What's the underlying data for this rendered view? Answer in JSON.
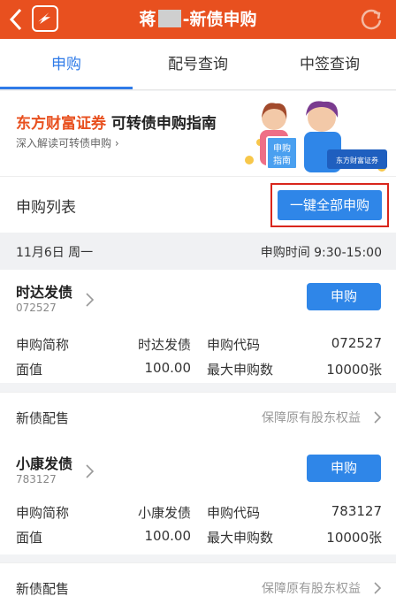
{
  "header": {
    "title_prefix": "蒋",
    "title_suffix": "-新债申购"
  },
  "tabs": [
    {
      "label": "申购",
      "active": true
    },
    {
      "label": "配号查询",
      "active": false
    },
    {
      "label": "中签查询",
      "active": false
    }
  ],
  "banner": {
    "brand": "东方财富证券",
    "title": " 可转债申购指南",
    "subtitle": "深入解读可转债申购",
    "chevron": "›",
    "sign_text_1": "申购",
    "sign_text_2": "指南",
    "board_text": "东方财富证券"
  },
  "list": {
    "title": "申购列表",
    "one_click_label": "一键全部申购"
  },
  "date_row": {
    "date": "11月6日  周一",
    "time_label": "申购时间  9:30-15:00"
  },
  "bonds": [
    {
      "name": "时达发债",
      "code": "072527",
      "buy_label": "申购",
      "row1": {
        "k1": "申购简称",
        "v1": "时达发债",
        "k2": "申购代码",
        "v2": "072527"
      },
      "row2": {
        "k1": "面值",
        "v1": "100.00",
        "k2": "最大申购数",
        "v2": "10000张"
      },
      "peishou_label": "新债配售",
      "peishou_value": "保障原有股东权益"
    },
    {
      "name": "小康发债",
      "code": "783127",
      "buy_label": "申购",
      "row1": {
        "k1": "申购简称",
        "v1": "小康发债",
        "k2": "申购代码",
        "v2": "783127"
      },
      "row2": {
        "k1": "面值",
        "v1": "100.00",
        "k2": "最大申购数",
        "v2": "10000张"
      },
      "peishou_label": "新债配售",
      "peishou_value": "保障原有股东权益"
    }
  ],
  "colors": {
    "header_bg": "#e8501f",
    "accent_blue": "#2f7be8",
    "highlight_red": "#d9261c"
  }
}
